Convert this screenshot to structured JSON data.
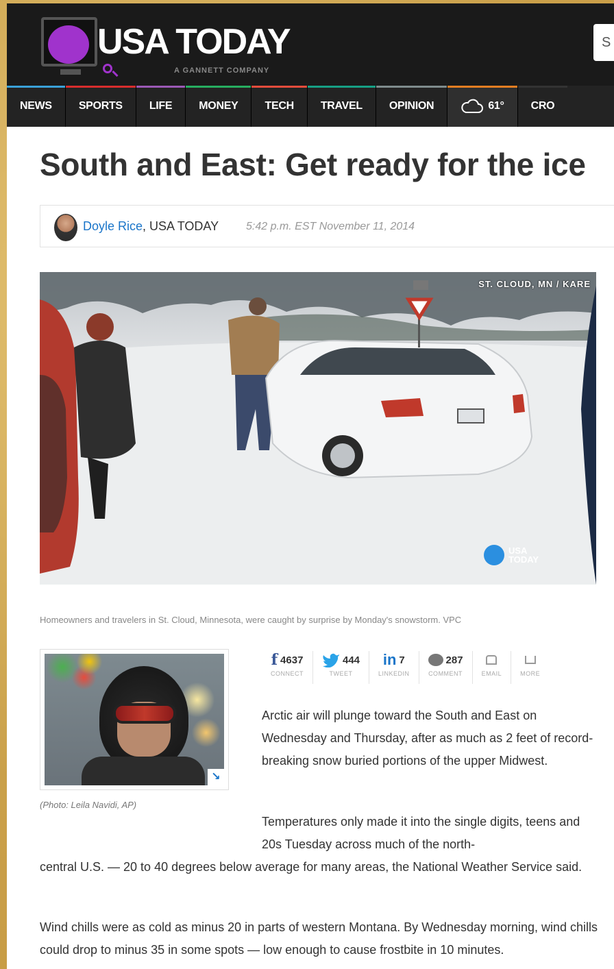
{
  "header": {
    "logo_text": "USA TODAY",
    "logo_sub": "A GANNETT COMPANY",
    "search_placeholder": "S"
  },
  "nav": {
    "items": [
      {
        "label": "NEWS",
        "color": "#3aa1d8"
      },
      {
        "label": "SPORTS",
        "color": "#d82d2d"
      },
      {
        "label": "LIFE",
        "color": "#9b59b6"
      },
      {
        "label": "MONEY",
        "color": "#27ae60"
      },
      {
        "label": "TECH",
        "color": "#e74c3c"
      },
      {
        "label": "TRAVEL",
        "color": "#16a085"
      },
      {
        "label": "OPINION",
        "color": "#7f8c8d"
      }
    ],
    "weather": {
      "icon": "cloud-icon",
      "temp": "61°"
    },
    "overflow_label": "CRO"
  },
  "article": {
    "headline": "South and East: Get ready for the ice",
    "byline": {
      "author": "Doyle Rice",
      "outlet": ", USA TODAY",
      "timestamp": "5:42 p.m. EST November 11, 2014"
    },
    "hero": {
      "overlay_tag": "ST. CLOUD, MN / KARE",
      "badge_text_line1": "USA",
      "badge_text_line2": "TODAY",
      "caption": "Homeowners and travelers in St. Cloud, Minnesota, were caught by surprise by Monday's snowstorm. VPC"
    },
    "photo_credit": "(Photo: Leila Navidi, AP)",
    "share": [
      {
        "icon": "facebook-icon",
        "count": "4637",
        "label": "CONNECT"
      },
      {
        "icon": "twitter-icon",
        "count": "444",
        "label": "TWEET"
      },
      {
        "icon": "linkedin-icon",
        "count": "7",
        "label": "LINKEDIN"
      },
      {
        "icon": "comment-icon",
        "count": "287",
        "label": "COMMENT"
      },
      {
        "icon": "email-icon",
        "count": "",
        "label": "EMAIL"
      },
      {
        "icon": "more-icon",
        "count": "",
        "label": "MORE"
      }
    ],
    "paragraphs": [
      "Arctic air will plunge toward the South and East on Wednesday and Thursday, after as much as 2 feet of record-breaking snow buried portions of the upper Midwest.",
      "Temperatures only made it into the single digits, teens and 20s Tuesday across much of the north-",
      "central U.S. — 20 to 40 degrees below average for many areas, the National Weather Service said.",
      "Wind chills were as cold as minus 20 in parts of western Montana. By Wednesday morning, wind chills could drop to minus 35 in some spots — low enough to cause frostbite in 10 minutes."
    ]
  }
}
